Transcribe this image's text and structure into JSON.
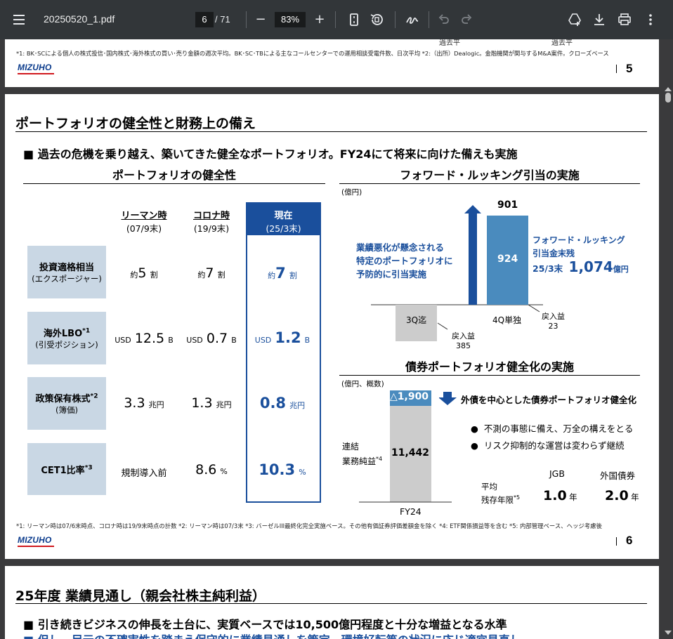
{
  "toolbar": {
    "file_name": "20250520_1.pdf",
    "current_page": "6",
    "page_count": "/ 71",
    "zoom": "83%",
    "zoom_out_label": "−",
    "zoom_in_label": "+"
  },
  "prev_page": {
    "footnote": "*1: BK･SCによる個人の株式投信･国内株式･海外株式の買い･売り金額の週次平均。BK･SC･TBによる主なコールセンターでの運用相談受電件数、日次平均 *2:（出所）Dealogic。金融機関が関与するM&A案件。クローズベース",
    "clip_left": "過去平",
    "clip_right": "過去平",
    "logo": "MIZUHO",
    "page_number": "5"
  },
  "page": {
    "title": "ポートフォリオの健全性と財務上の備え",
    "bullet": "■ 過去の危機を乗り越え、築いてきた健全なポートフォリオ。FY24にて将来に向けた備えも実施",
    "left_title": "ポートフォリオの健全性",
    "columns": [
      {
        "main": "リーマン時",
        "sub": "(07/9末)"
      },
      {
        "main": "コロナ時",
        "sub": "(19/9末)"
      },
      {
        "main": "現在",
        "sub": "(25/3末)"
      }
    ],
    "rows": [
      {
        "label": "投資適格相当",
        "label_sup": "",
        "label_sub": "(エクスポージャー)",
        "values": [
          {
            "pre": "約",
            "big": "5",
            "post": "割"
          },
          {
            "pre": "約",
            "big": "7",
            "post": "割"
          },
          {
            "pre": "約",
            "big": "7",
            "post": "割"
          }
        ]
      },
      {
        "label": "海外LBO",
        "label_sup": "*1",
        "label_sub": "(引受ポジション)",
        "values": [
          {
            "pre": "USD",
            "big": "12.5",
            "post": "B"
          },
          {
            "pre": "USD",
            "big": "0.7",
            "post": "B"
          },
          {
            "pre": "USD",
            "big": "1.2",
            "post": "B"
          }
        ]
      },
      {
        "label": "政策保有株式",
        "label_sup": "*2",
        "label_sub": "(簿価)",
        "values": [
          {
            "pre": "",
            "big": "3.3",
            "post": "兆円"
          },
          {
            "pre": "",
            "big": "1.3",
            "post": "兆円"
          },
          {
            "pre": "",
            "big": "0.8",
            "post": "兆円"
          }
        ]
      },
      {
        "label": "CET1比率",
        "label_sup": "*3",
        "label_sub": "",
        "values": [
          {
            "pre": "",
            "big": "規制導入前",
            "post": ""
          },
          {
            "pre": "",
            "big": "8.6",
            "post": "%"
          },
          {
            "pre": "",
            "big": "10.3",
            "post": "%"
          }
        ]
      }
    ],
    "right_top_title": "フォワード・ルッキング引当の実施",
    "right_top_unit": "(億円)",
    "right_top_arrow_text": [
      "業績悪化が懸念される",
      "特定のポートフォリオに",
      "予防的に引当実施"
    ],
    "right_top_label_901": "901",
    "right_top_label_924": "924",
    "right_top_label_3q": "3Q迄",
    "right_top_label_4q": "4Q単独",
    "right_top_reversal_3q": [
      "戻入益",
      "385"
    ],
    "right_top_reversal_4q": [
      "戻入益",
      "23"
    ],
    "right_top_note": [
      "フォワード・ルッキング",
      "引当金末残"
    ],
    "right_top_note_date": "25/3末",
    "right_top_note_value": "1,074",
    "right_top_note_unit": "億円",
    "right_bottom_title": "債券ポートフォリオ健全化の実施",
    "right_bottom_unit": "(億円、概数)",
    "right_bottom_delta": "△1,900",
    "right_bottom_value": "11,442",
    "right_bottom_ylabel": [
      "連結",
      "業務純益"
    ],
    "right_bottom_ylabel_sup": "*4",
    "right_bottom_x": "FY24",
    "right_bottom_headline": "外債を中心とした債券ポートフォリオ健全化",
    "right_bottom_bullets": [
      "不測の事態に備え、万全の構えをとる",
      "リスク抑制的な運営は変わらず継続"
    ],
    "right_bottom_col_jgb": "JGB",
    "right_bottom_col_foreign": "外国債券",
    "right_bottom_row_label": [
      "平均",
      "残存年限"
    ],
    "right_bottom_row_sup": "*5",
    "right_bottom_jgb_value": "1.0",
    "right_bottom_foreign_value": "2.0",
    "right_bottom_year": "年",
    "footnote": "*1: リーマン時は07/6末時点、コロナ時は19/9末時点の計数 *2: リーマン時は07/3末 *3: バーゼルIII最終化完全実施ベース。その他有価証券評価差額金を除く *4: ETF関係損益等を含む *5: 内部管理ベース、ヘッジ考慮後",
    "logo": "MIZUHO",
    "page_number": "6"
  },
  "next_page": {
    "title": "25年度 業績見通し（親会社株主純利益）",
    "bullet1": "■ 引き続きビジネスの伸長を土台に、実質ベースでは10,500億円程度と十分な増益となる水準",
    "bullet2": "■ 但し、足元の不確実性を踏まえ保守的に業績見通しを策定。環境好転等の状況に応じ適宜見直し"
  },
  "chart_data": [
    {
      "type": "bar",
      "title": "フォワード・ルッキング引当の実施",
      "ylabel": "(億円)",
      "categories": [
        "3Q迄",
        "4Q単独"
      ],
      "values": [
        -385,
        924
      ],
      "annotations": [
        "901",
        "戻入益 385",
        "戻入益 23",
        "25/3末 1,074億円"
      ]
    },
    {
      "type": "bar",
      "title": "債券ポートフォリオ健全化の実施",
      "ylabel": "(億円、概数)",
      "categories": [
        "FY24"
      ],
      "values": [
        11442
      ],
      "annotations": [
        "△1,900"
      ]
    }
  ],
  "colors": {
    "toolbar_bg": "#323639",
    "accent_blue": "#1a4f9c",
    "label_bg": "#c9d7e4",
    "bar_blue": "#4a8bbe",
    "bar_grey": "#cccccc",
    "mizuho_red": "#d0181e"
  }
}
